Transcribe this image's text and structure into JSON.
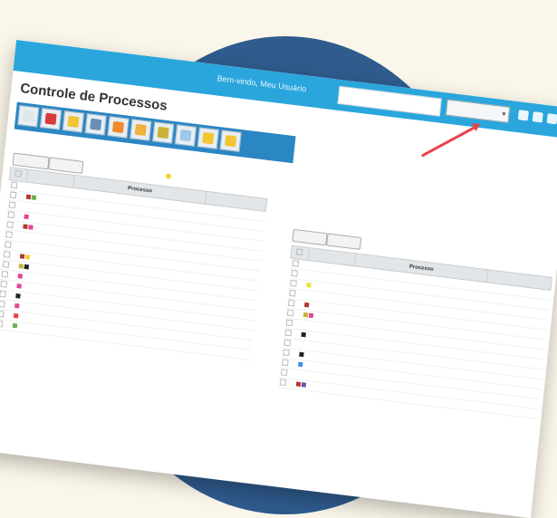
{
  "header": {
    "greeting": "Bem-vindo, Meu Usuário",
    "select_value": "",
    "search_placeholder": ""
  },
  "page_title": "Controle de Processos",
  "toolbar": {
    "icons": [
      "file-icon",
      "edit-icon",
      "star-icon",
      "print-icon",
      "export-icon",
      "document-icon",
      "alert-icon",
      "calendar-icon",
      "mail-icon",
      "help-icon"
    ],
    "colors": [
      "#dfe6ea",
      "#d83a3a",
      "#f2c535",
      "#6a8fb8",
      "#f28b2e",
      "#f0b23c",
      "#c9b23a",
      "#9ec7e8",
      "#f2c535",
      "#f2c535"
    ]
  },
  "left_panel": {
    "caption": "",
    "buttons": [
      "",
      ""
    ],
    "legend": "",
    "columns": [
      "",
      "",
      "Processo",
      ""
    ],
    "rows": [
      {
        "marks": [],
        "item": "",
        "value": "",
        "highlight": false
      },
      {
        "marks": [
          "#b03a2e",
          "#6ab04c"
        ],
        "item": "",
        "value": "",
        "highlight": false
      },
      {
        "marks": [],
        "item": "",
        "value": "",
        "highlight": false
      },
      {
        "marks": [
          "#e84393"
        ],
        "item": "",
        "value": "",
        "highlight": true
      },
      {
        "marks": [
          "#b03a2e",
          "#e84393"
        ],
        "item": "",
        "value": "",
        "highlight": false
      },
      {
        "marks": [],
        "item": "",
        "value": "",
        "highlight": false
      },
      {
        "marks": [],
        "item": "",
        "value": "",
        "highlight": false
      },
      {
        "marks": [
          "#b03a2e",
          "#f2d43a"
        ],
        "item": "",
        "value": "",
        "highlight": false
      },
      {
        "marks": [
          "#c7b23a",
          "#222222"
        ],
        "item": "",
        "value": "",
        "highlight": false
      },
      {
        "marks": [
          "#e84393"
        ],
        "item": "",
        "value": "",
        "highlight": false
      },
      {
        "marks": [
          "#e84393"
        ],
        "item": "",
        "value": "",
        "highlight": false
      },
      {
        "marks": [
          "#222222"
        ],
        "item": "",
        "value": "",
        "highlight": false
      },
      {
        "marks": [
          "#e84393"
        ],
        "item": "",
        "value": "",
        "highlight": false
      },
      {
        "marks": [
          "#e8424a"
        ],
        "item": "",
        "value": "",
        "highlight": false
      },
      {
        "marks": [
          "#6ab04c"
        ],
        "item": "",
        "value": "",
        "highlight": false
      }
    ]
  },
  "right_panel": {
    "caption": "",
    "buttons": [
      "",
      ""
    ],
    "columns": [
      "",
      "",
      "Processo",
      ""
    ],
    "rows": [
      {
        "marks": [],
        "item": "",
        "value": ""
      },
      {
        "marks": [],
        "item": "",
        "value": ""
      },
      {
        "marks": [
          "#f2e03a"
        ],
        "item": "",
        "value": ""
      },
      {
        "marks": [],
        "item": "",
        "value": ""
      },
      {
        "marks": [
          "#b03a2e"
        ],
        "item": "",
        "value": ""
      },
      {
        "marks": [
          "#c7b23a",
          "#e84393"
        ],
        "item": "",
        "value": ""
      },
      {
        "marks": [],
        "item": "",
        "value": ""
      },
      {
        "marks": [
          "#222222"
        ],
        "item": "",
        "value": ""
      },
      {
        "marks": [],
        "item": "",
        "value": ""
      },
      {
        "marks": [
          "#222222"
        ],
        "item": "",
        "value": ""
      },
      {
        "marks": [
          "#3a8ee0"
        ],
        "item": "",
        "value": ""
      },
      {
        "marks": [],
        "item": "",
        "value": ""
      },
      {
        "marks": [
          "#b03a2e",
          "#7a4ab0"
        ],
        "item": "",
        "value": ""
      }
    ]
  }
}
